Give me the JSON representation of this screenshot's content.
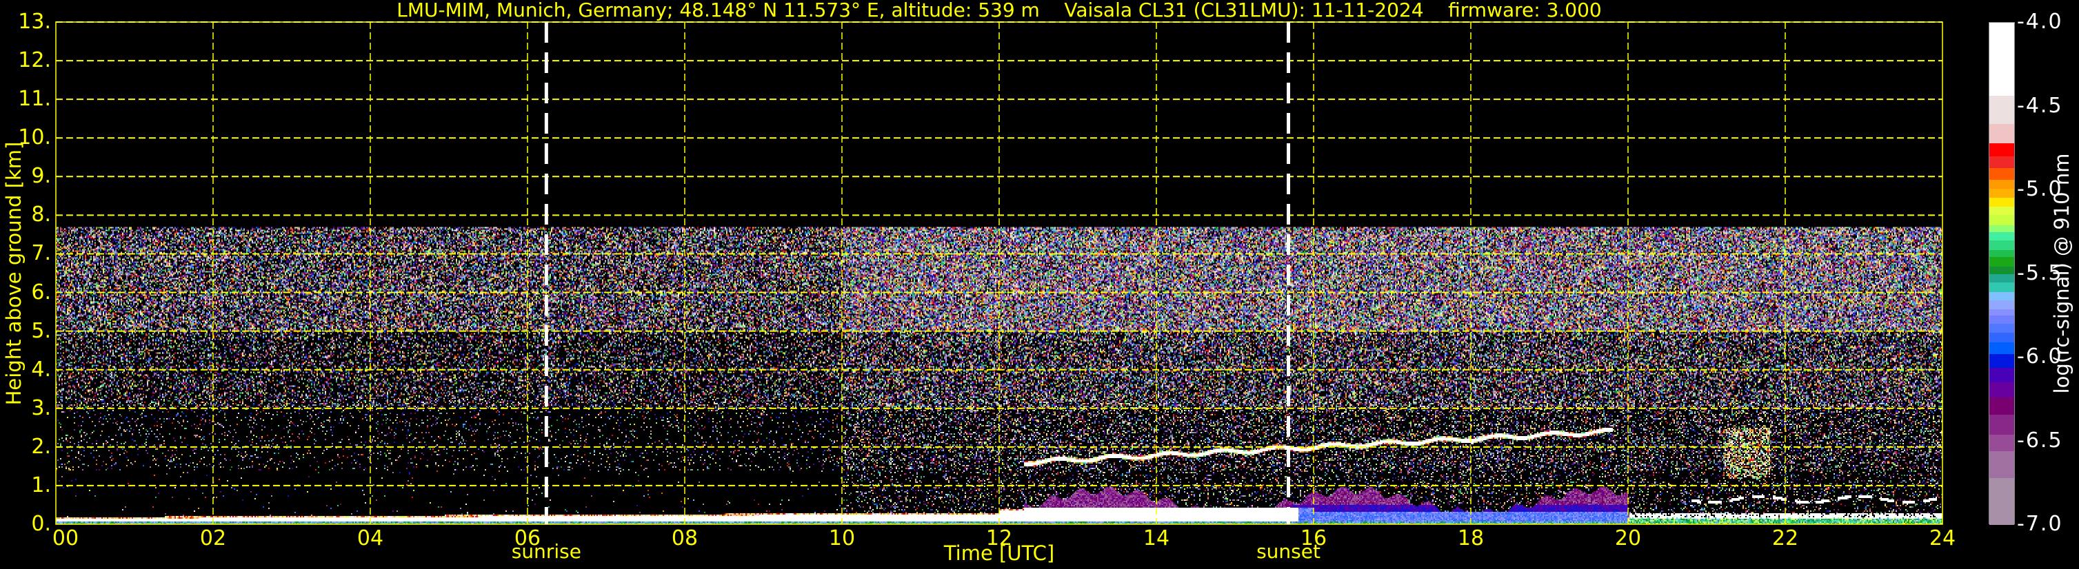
{
  "chart_data": {
    "type": "heatmap",
    "title": "LMU-MIM, Munich, Germany; 48.148° N 11.573° E, altitude: 539 m    Vaisala CL31 (CL31LMU): 11-11-2024    firmware: 3.000",
    "xlabel": "Time [UTC]",
    "ylabel": "Height above ground [km]",
    "xlim": [
      0,
      24
    ],
    "ylim": [
      0,
      13
    ],
    "x_ticks": [
      "00",
      "02",
      "04",
      "06",
      "08",
      "10",
      "12",
      "14",
      "16",
      "18",
      "20",
      "22",
      "24"
    ],
    "y_ticks": [
      "0.",
      "1.",
      "2.",
      "3.",
      "4.",
      "5.",
      "6.",
      "7.",
      "8.",
      "9.",
      "10.",
      "11.",
      "12.",
      "13."
    ],
    "grid": true,
    "events": [
      {
        "label": "sunrise",
        "time": 6.24
      },
      {
        "label": "sunset",
        "time": 15.68
      }
    ],
    "colorbar": {
      "label": "log(rc-signal) @ 910 nm",
      "range": [
        -7.0,
        -4.0
      ],
      "ticks": [
        "-4.0",
        "-4.5",
        "-5.0",
        "-5.5",
        "-6.0",
        "-6.5",
        "-7.0"
      ],
      "bounds": [
        -4.0,
        -4.437,
        -4.606,
        -4.719,
        -4.8,
        -4.87,
        -4.937,
        -4.99,
        -5.045,
        -5.1,
        -5.15,
        -5.21,
        -5.25,
        -5.3,
        -5.357,
        -5.4,
        -5.457,
        -5.5,
        -5.55,
        -5.61,
        -5.66,
        -5.71,
        -5.75,
        -5.8,
        -5.85,
        -5.91,
        -5.98,
        -6.06,
        -6.15,
        -6.24,
        -6.34,
        -6.46,
        -6.56,
        -6.72,
        -7.0
      ],
      "colors": [
        "#ffffff",
        "#ede0e0",
        "#f0c4c4",
        "#ff0000",
        "#f02828",
        "#ff5a00",
        "#ff9a00",
        "#ffb000",
        "#ffe800",
        "#e0ff40",
        "#c8ff40",
        "#90ff70",
        "#40f0a0",
        "#30d880",
        "#20c050",
        "#1aa818",
        "#139030",
        "#20a890",
        "#30c8b0",
        "#80c0ff",
        "#90a8ff",
        "#8890ff",
        "#7080ff",
        "#5078ff",
        "#3068ff",
        "#0060ff",
        "#0018e0",
        "#4800b8",
        "#6800a0",
        "#780070",
        "#882888",
        "#984c98",
        "#a070a0",
        "#a890a8"
      ]
    },
    "features": {
      "max_signal_height_km": 7.7,
      "surface_layer": {
        "time_range": [
          0,
          24
        ],
        "top_km_start": 0.2,
        "top_km_noon": 0.35
      },
      "elevated_cloud_layer": {
        "time_range": [
          12.3,
          19.8
        ],
        "base_km_start": 1.55,
        "base_km_end": 2.35
      },
      "aerosol_layer": {
        "time_range": [
          12.3,
          20.0
        ],
        "top_km": 1.0
      },
      "low_clouds_evening": {
        "time_range": [
          20.0,
          24.0
        ],
        "heights_km": [
          0.2,
          0.7
        ]
      }
    },
    "colors": {
      "axis_text": "#ffff00",
      "grid": "#ffff00",
      "event_line": "#ffffff",
      "background": "#000000"
    }
  }
}
